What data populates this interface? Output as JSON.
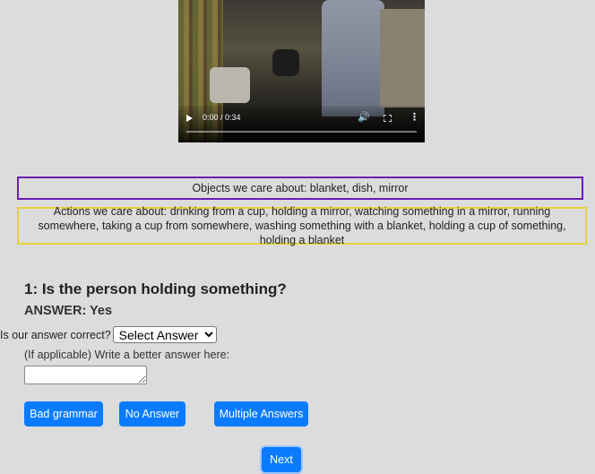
{
  "video": {
    "time": "0:00 / 0:34",
    "progress": 0
  },
  "objects_text": "Objects we care about: blanket, dish, mirror",
  "actions_text": "Actions we care about: drinking from a cup, holding a mirror, watching something in a mirror, running somewhere, taking a cup from somewhere, washing something with a blanket, holding a cup of something, holding a blanket",
  "question": {
    "title": "1: Is the person holding something?",
    "answer": "ANSWER: Yes",
    "correct_label": "Is our answer correct?",
    "select_value": "Select Answer",
    "better_label": "(If applicable) Write a better answer here:",
    "better_value": ""
  },
  "buttons": {
    "bad_grammar": "Bad grammar",
    "no_answer": "No Answer",
    "multiple_answers": "Multiple Answers",
    "next": "Next"
  },
  "colors": {
    "objects_border": "#6a1fb5",
    "actions_border": "#e6d23a",
    "button": "#0a7bff",
    "background": "#dcdcdc"
  },
  "icons": [
    "play-icon",
    "volume-icon",
    "fullscreen-icon",
    "more-icon"
  ]
}
